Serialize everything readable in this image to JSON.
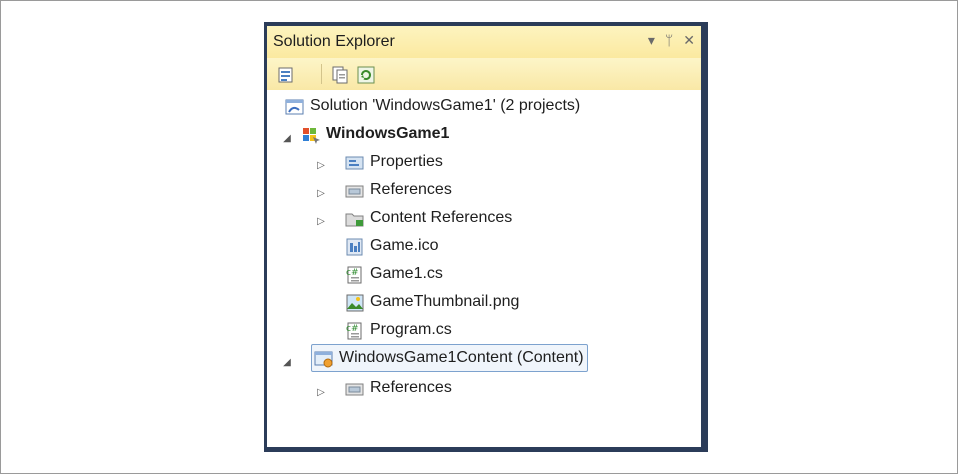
{
  "panel": {
    "title": "Solution Explorer",
    "title_buttons": [
      "▾",
      "ᛘ",
      "✕"
    ]
  },
  "tree": {
    "solution": "Solution 'WindowsGame1' (2 projects)",
    "project1": {
      "label": "WindowsGame1",
      "expander": "◢",
      "items": [
        {
          "label": "Properties",
          "expander": "▷"
        },
        {
          "label": "References",
          "expander": "▷"
        },
        {
          "label": "Content References",
          "expander": "▷"
        },
        {
          "label": "Game.ico"
        },
        {
          "label": "Game1.cs"
        },
        {
          "label": "GameThumbnail.png"
        },
        {
          "label": "Program.cs"
        }
      ]
    },
    "project2": {
      "label": "WindowsGame1Content (Content)",
      "expander": "◢",
      "items": [
        {
          "label": "References",
          "expander": "▷"
        }
      ]
    }
  },
  "colors": {
    "titlebar": "#fbe9a0",
    "selection_border": "#7da2ce"
  }
}
